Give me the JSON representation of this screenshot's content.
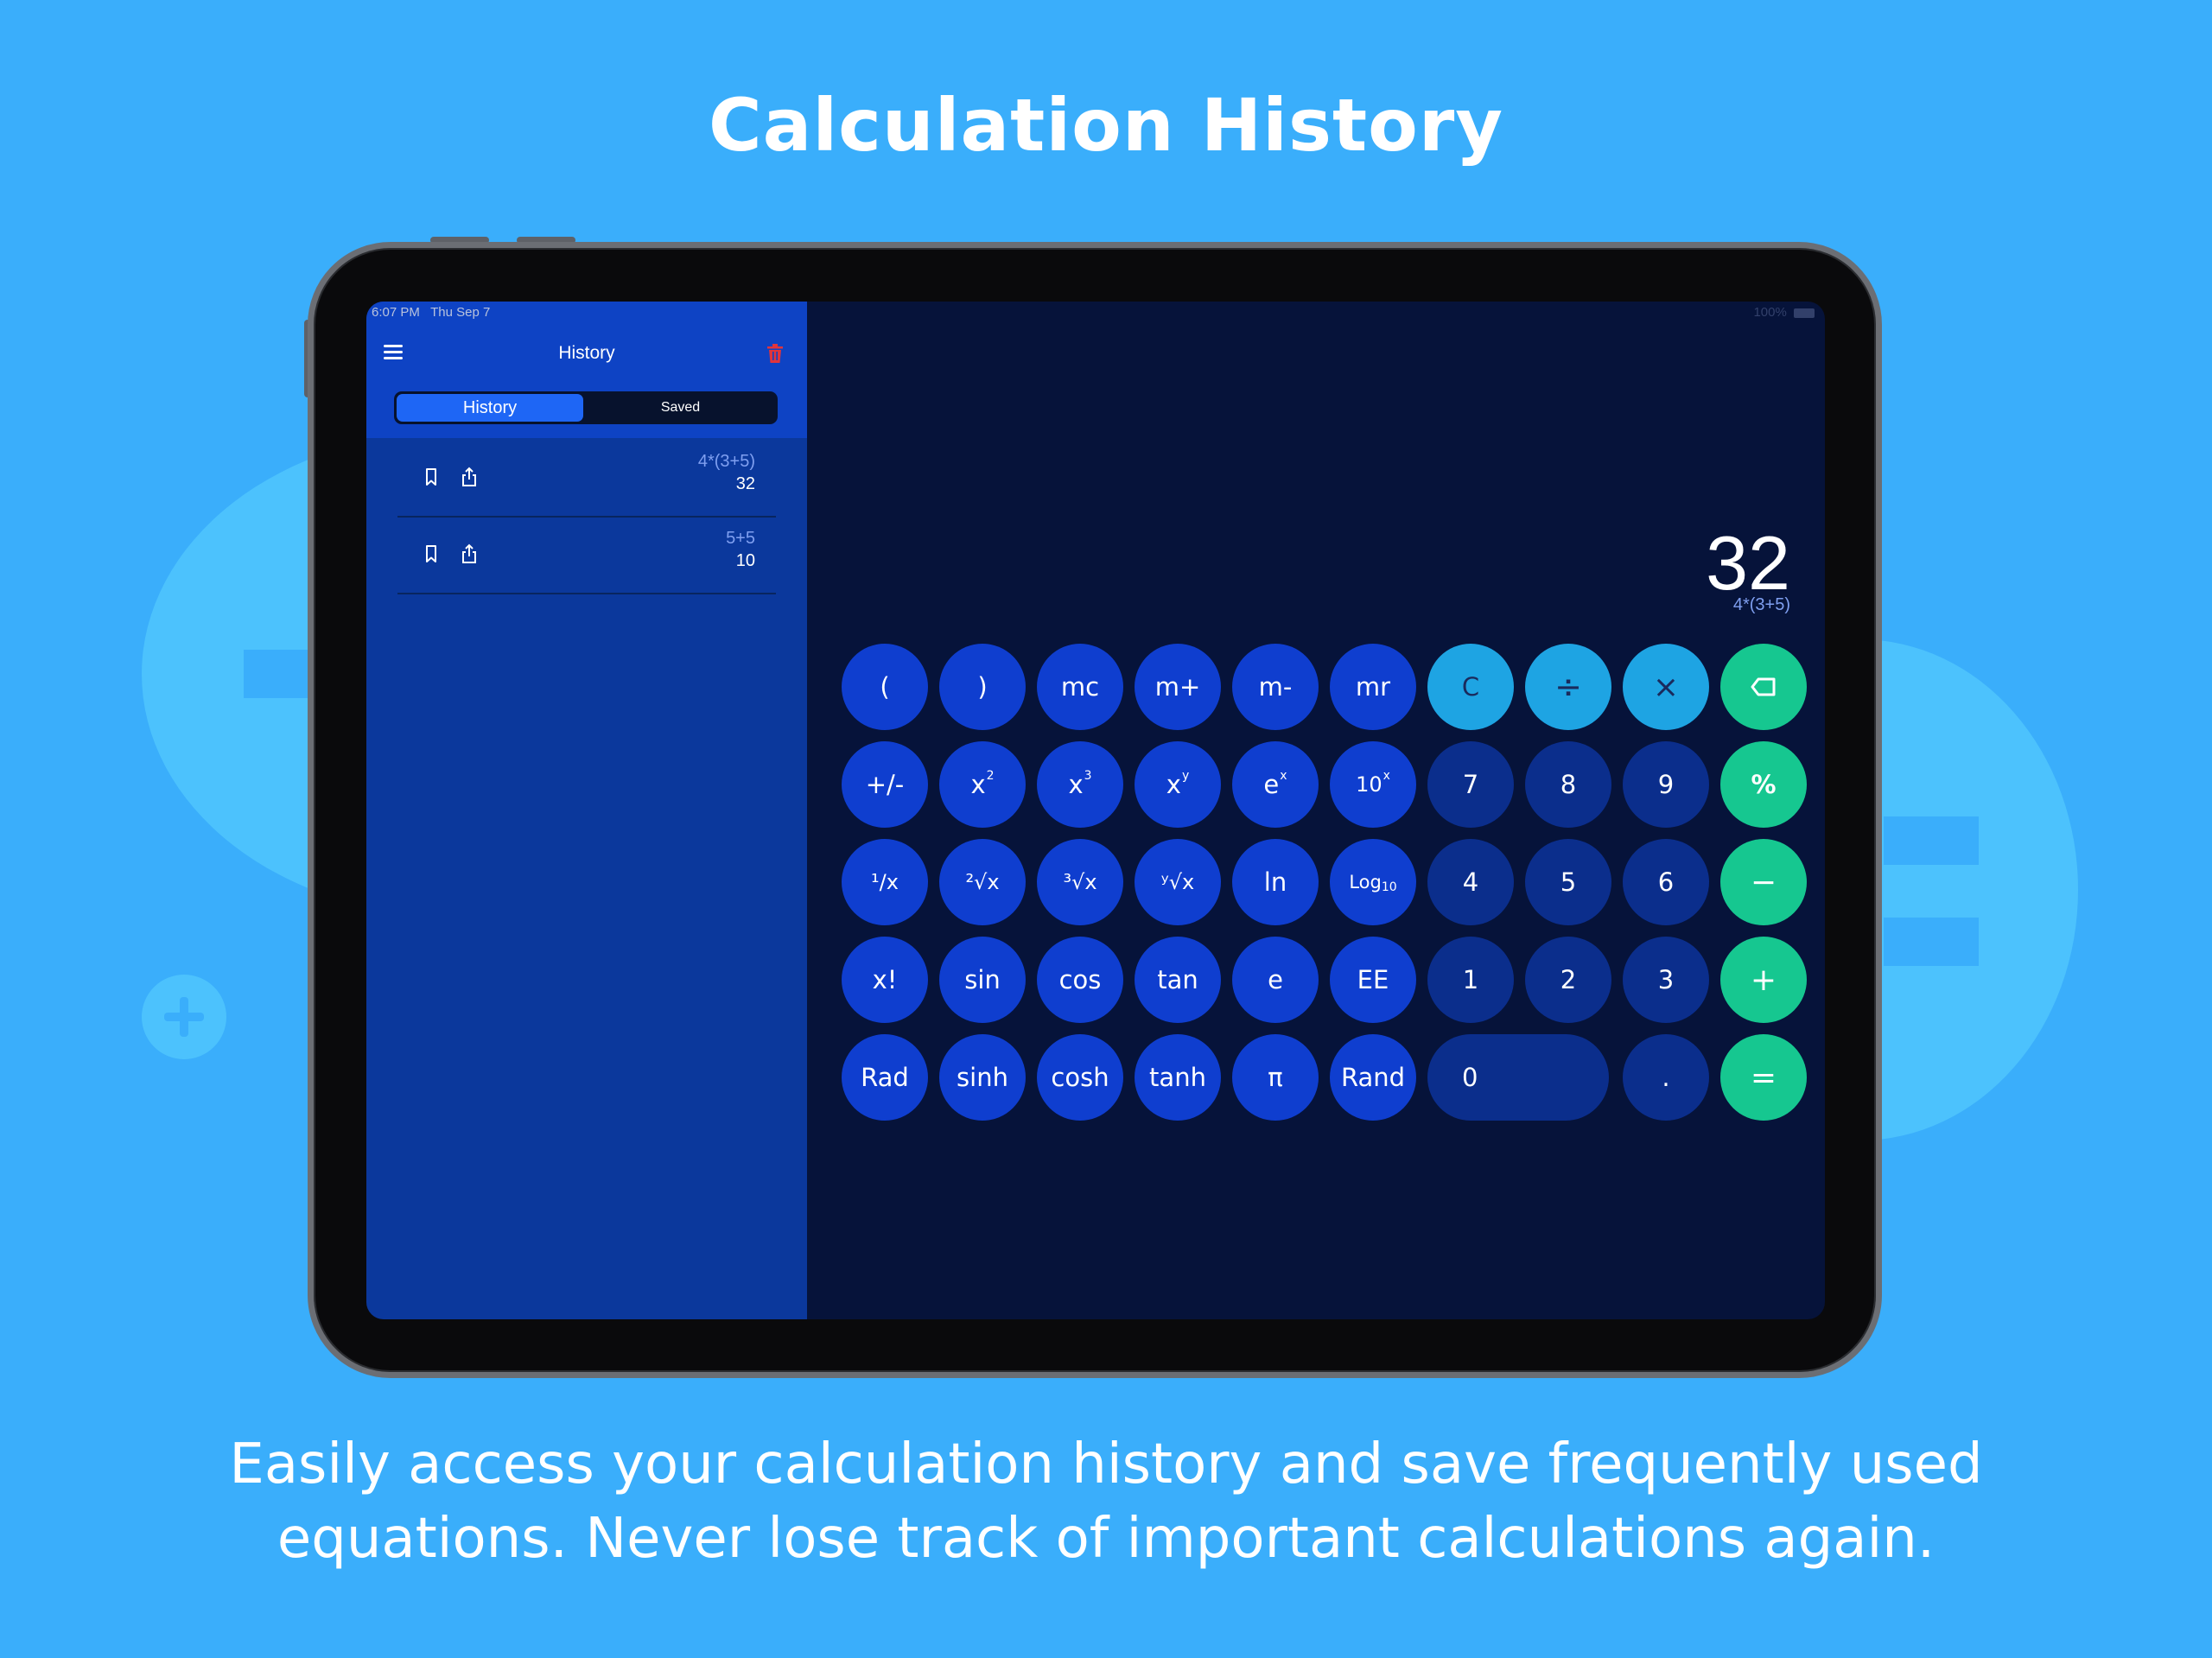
{
  "headline": "Calculation History",
  "subtitle_line1": "Easily access your calculation history and save frequently used",
  "subtitle_line2": "equations. Never lose track of important calculations again.",
  "status_bar": {
    "time": "6:07 PM",
    "date": "Thu Sep 7",
    "battery": "100%"
  },
  "sidebar": {
    "title": "History",
    "tabs": {
      "history": "History",
      "saved": "Saved"
    },
    "items": [
      {
        "expression": "4*(3+5)",
        "result": "32"
      },
      {
        "expression": "5+5",
        "result": "10"
      }
    ]
  },
  "display": {
    "value": "32",
    "expression": "4*(3+5)"
  },
  "keys": {
    "open_paren": "(",
    "close_paren": ")",
    "mc": "mc",
    "m_plus": "m+",
    "m_minus": "m-",
    "mr": "mr",
    "clear": "C",
    "divide": "÷",
    "multiply": "×",
    "plus_minus": "+/-",
    "x_squared_base": "x",
    "x_squared_exp": "2",
    "x_cubed_base": "x",
    "x_cubed_exp": "3",
    "x_pow_y_base": "x",
    "x_pow_y_exp": "y",
    "e_pow_x_base": "e",
    "e_pow_x_exp": "x",
    "ten_pow_x_base": "10",
    "ten_pow_x_exp": "x",
    "seven": "7",
    "eight": "8",
    "nine": "9",
    "percent": "%",
    "reciprocal": "¹/x",
    "sqrt2": "²√x",
    "sqrt3": "³√x",
    "sqrty": "ʸ√x",
    "ln": "ln",
    "log_base": "Log",
    "log_sub": "10",
    "four": "4",
    "five": "5",
    "six": "6",
    "minus": "−",
    "factorial": "x!",
    "sin": "sin",
    "cos": "cos",
    "tan": "tan",
    "e": "e",
    "ee": "EE",
    "one": "1",
    "two": "2",
    "three": "3",
    "plus": "+",
    "rad": "Rad",
    "sinh": "sinh",
    "cosh": "cosh",
    "tanh": "tanh",
    "pi": "π",
    "rand": "Rand",
    "zero": "0",
    "dot": ".",
    "equals": "="
  },
  "colors": {
    "background": "#3aaefb",
    "sidebar": "#0b389c",
    "screen": "#06133a",
    "function_key": "#0f3ecf",
    "number_key": "#0b2e8c",
    "light_key": "#1ea4e3",
    "accent_green": "#16c790",
    "delete_icon": "#e0343c"
  }
}
